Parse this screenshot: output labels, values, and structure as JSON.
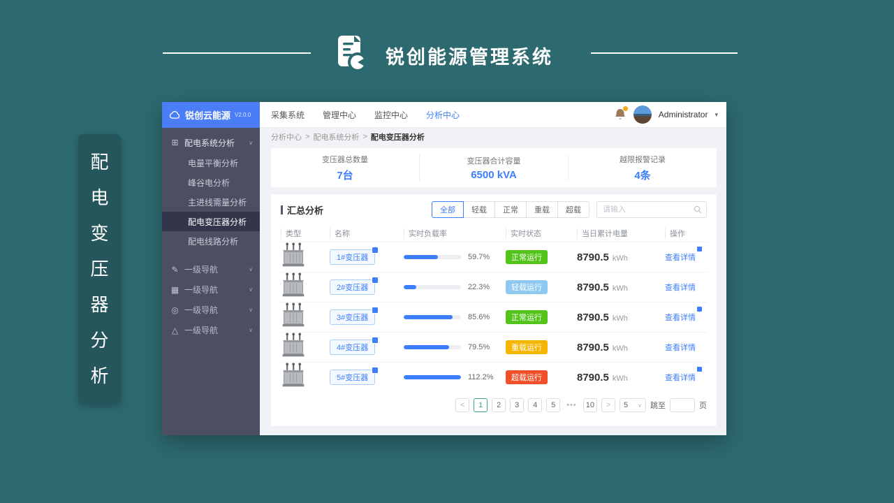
{
  "banner": {
    "title": "锐创能源管理系统",
    "side_label_chars": [
      "配",
      "电",
      "变",
      "压",
      "器",
      "分",
      "析"
    ]
  },
  "icons": {
    "chevron_down": "∨",
    "caret_down": "▾",
    "group_icon": "⊞",
    "nav_icon_1": "✎",
    "nav_icon_2": "▦",
    "nav_icon_3": "◎",
    "nav_icon_4": "△"
  },
  "app": {
    "logo": {
      "name": "锐创云能源",
      "version": "V2.0.0"
    },
    "sidebar": {
      "group_label": "配电系统分析",
      "sub_items": [
        {
          "label": "电量平衡分析"
        },
        {
          "label": "峰谷电分析"
        },
        {
          "label": "主进线需量分析"
        },
        {
          "label": "配电变压器分析"
        },
        {
          "label": "配电线路分析"
        }
      ],
      "nav_items": [
        {
          "label": "一级导航"
        },
        {
          "label": "一级导航"
        },
        {
          "label": "一级导航"
        },
        {
          "label": "一级导航"
        }
      ]
    },
    "topnav": {
      "items": [
        {
          "label": "采集系统"
        },
        {
          "label": "管理中心"
        },
        {
          "label": "监控中心"
        },
        {
          "label": "分析中心"
        }
      ],
      "user_name": "Administrator"
    },
    "breadcrumb": {
      "separator": ">",
      "crumbs": [
        "分析中心",
        "配电系统分析",
        "配电变压器分析"
      ]
    },
    "stats": [
      {
        "label": "变压器总数量",
        "value": "7台"
      },
      {
        "label": "变压器合计容量",
        "value": "6500 kVA"
      },
      {
        "label": "越限报警记录",
        "value": "4条"
      }
    ],
    "summary": {
      "title": "汇总分析",
      "filters": [
        {
          "label": "全部"
        },
        {
          "label": "轻载"
        },
        {
          "label": "正常"
        },
        {
          "label": "重载"
        },
        {
          "label": "超载"
        }
      ],
      "search_placeholder": "请输入",
      "table": {
        "headers": [
          "类型",
          "名称",
          "实时负载率",
          "实时状态",
          "当日累计电量",
          "操作"
        ],
        "action_label": "查看详情",
        "energy_unit": "kWh",
        "rows": [
          {
            "name": "1#变压器",
            "load_label": "59.7%",
            "load_pct": 59.7,
            "status": "正常运行",
            "status_color": "#52c41a",
            "energy": "8790.5"
          },
          {
            "name": "2#变压器",
            "load_label": "22.3%",
            "load_pct": 22.3,
            "status": "轻载运行",
            "status_color": "#8fc9f2",
            "energy": "8790.5"
          },
          {
            "name": "3#变压器",
            "load_label": "85.6%",
            "load_pct": 85.6,
            "status": "正常运行",
            "status_color": "#52c41a",
            "energy": "8790.5"
          },
          {
            "name": "4#变压器",
            "load_label": "79.5%",
            "load_pct": 79.5,
            "status": "重载运行",
            "status_color": "#f6b500",
            "energy": "8790.5"
          },
          {
            "name": "5#变压器",
            "load_label": "112.2%",
            "load_pct": 112.2,
            "status": "超载运行",
            "status_color": "#f0502a",
            "energy": "8790.5"
          }
        ]
      },
      "pagination": {
        "prev": "<",
        "next": ">",
        "pages": [
          "1",
          "2",
          "3",
          "4",
          "5",
          "•••",
          "10"
        ],
        "page_size": "5",
        "jump_label": "跳至",
        "unit_label": "页"
      }
    }
  }
}
